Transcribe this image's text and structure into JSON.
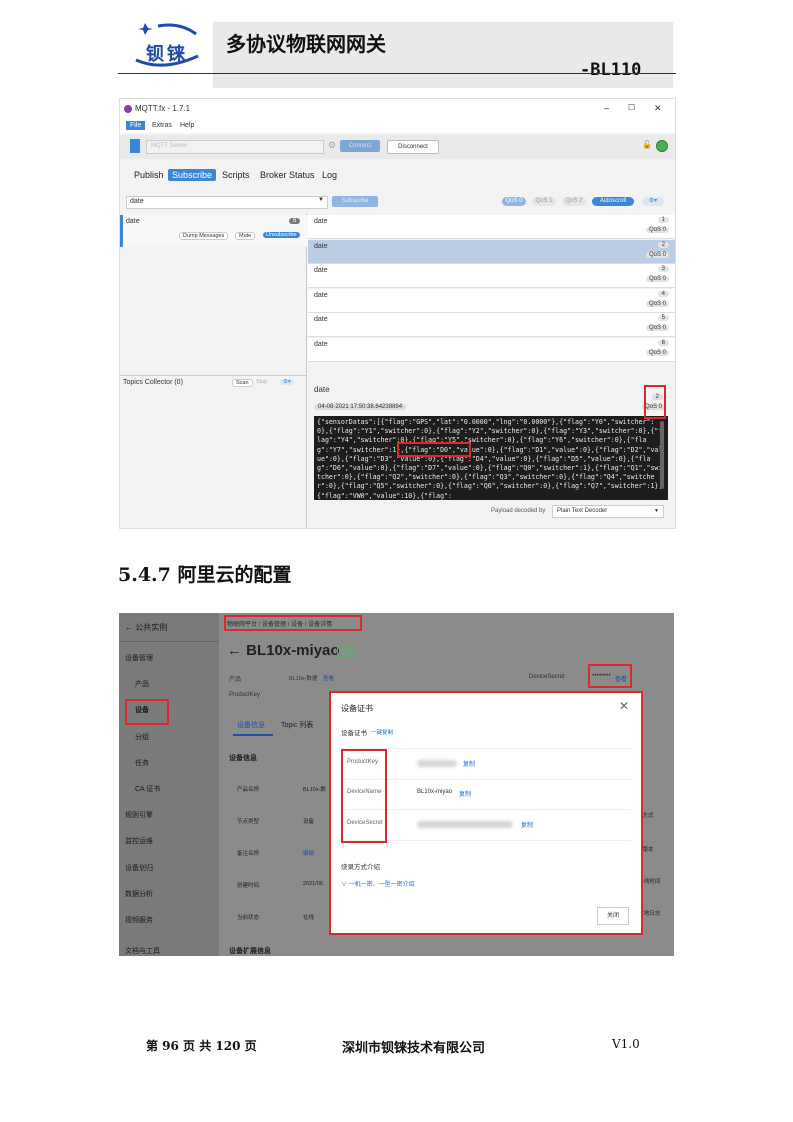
{
  "header": {
    "logo_text": "钡铼",
    "title": "多协议物联网网关",
    "model": "-BL110"
  },
  "mqtt": {
    "window_title": "MQTT.fx - 1.7.1",
    "window_controls": [
      "–",
      "☐",
      "✕"
    ],
    "menu": [
      "File",
      "Extras",
      "Help"
    ],
    "server_placeholder": "MQTT Server",
    "connect_label": "Connect",
    "disconnect_label": "Disconnect",
    "tabs": [
      "Publish",
      "Subscribe",
      "Scripts",
      "Broker Status",
      "Log"
    ],
    "active_tab": "Subscribe",
    "topic_value": "date",
    "subscribe_label": "Subscribe",
    "qos_options": [
      "QoS 0",
      "QoS 1",
      "QoS 2"
    ],
    "autoscroll_label": "Autoscroll",
    "subscription": {
      "topic": "date",
      "count": "6",
      "dump_label": "Dump Messages",
      "mute_label": "Mute",
      "unsubscribe_label": "Unsubscribe"
    },
    "messages": [
      {
        "topic": "date",
        "num": "1",
        "qos": "QoS 0"
      },
      {
        "topic": "date",
        "num": "2",
        "qos": "QoS 0"
      },
      {
        "topic": "date",
        "num": "3",
        "qos": "QoS 0"
      },
      {
        "topic": "date",
        "num": "4",
        "qos": "QoS 0"
      },
      {
        "topic": "date",
        "num": "5",
        "qos": "QoS 0"
      },
      {
        "topic": "date",
        "num": "6",
        "qos": "QoS 0"
      }
    ],
    "topics_collector": "Topics Collector (0)",
    "scan_label": "Scan",
    "stop_label": "Stop",
    "detail": {
      "topic": "date",
      "num": "2",
      "qos": "QoS 0",
      "timestamp": "04-08-2021  17:50:38.64238894",
      "payload": "{\"sensorDatas\":[{\"flag\":\"GPS\",\"lat\":\"0.0000\",\"lng\":\"0.0000\"},{\"flag\":\"Y0\",\"switcher\":0},{\"flag\":\"Y1\",\"switcher\":0},{\"flag\":\"Y2\",\"switcher\":0},{\"flag\":\"Y3\",\"switcher\":0},{\"flag\":\"Y4\",\"switcher\":0},{\"flag\":\"Y5\",\"switcher\":0},{\"flag\":\"Y6\",\"switcher\":0},{\"flag\":\"Y7\",\"switcher\":1},{\"flag\":\"D0\",\"value\":0},{\"flag\":\"D1\",\"value\":0},{\"flag\":\"D2\",\"value\":0},{\"flag\":\"D3\",\"value\":0},{\"flag\":\"D4\",\"value\":0},{\"flag\":\"D5\",\"value\":0},{\"flag\":\"D6\",\"value\":0},{\"flag\":\"D7\",\"value\":0},{\"flag\":\"Q0\",\"switcher\":1},{\"flag\":\"Q1\",\"switcher\":0},{\"flag\":\"Q2\",\"switcher\":0},{\"flag\":\"Q3\",\"switcher\":0},{\"flag\":\"Q4\",\"switcher\":0},{\"flag\":\"Q5\",\"switcher\":0},{\"flag\":\"Q6\",\"switcher\":0},{\"flag\":\"Q7\",\"switcher\":1},{\"flag\":\"VW0\",\"value\":10},{\"flag\":"
    },
    "decoder_label": "Payload decoded by",
    "decoder_value": "Plain Text Decoder"
  },
  "section_title": "5.4.7 阿里云的配置",
  "aliyun": {
    "back_label": "← 公共实例",
    "breadcrumb": [
      "物联网平台",
      "设备管理",
      "设备",
      "设备详情"
    ],
    "sidebar": [
      "设备管理",
      "产品",
      "设备",
      "分组",
      "任务",
      "CA 证书",
      "规则引擎",
      "监控运维",
      "设备划归",
      "数据分析",
      "视频服务",
      "文档与工具"
    ],
    "device_title": "← BL10x-miyao",
    "status": "在线",
    "product_label": "产品",
    "product_value": "BL10x-数据",
    "productkey_label": "ProductKey",
    "view_link": "查看",
    "devicesecret_label": "DeviceSecret",
    "secret_mask": "********",
    "tabs": [
      "设备信息",
      "Topic 列表"
    ],
    "info_title": "设备信息",
    "info_rows": [
      "产品名称",
      "节点类型",
      "备注名称",
      "创建时间",
      "当前状态"
    ],
    "info_values": [
      "BL10x-数",
      "设备",
      "编辑",
      "2021/06",
      "在线"
    ],
    "right_labels": [
      "证方式",
      "件版本",
      "后上线时间",
      "备本地日志"
    ],
    "ext_title": "设备扩展信息",
    "modal": {
      "title": "设备证书",
      "subtitle": "设备证书",
      "copy_all": "一键复制",
      "rows": [
        {
          "label": "ProductKey",
          "value": "",
          "action": "复制"
        },
        {
          "label": "DeviceName",
          "value": "BL10x-miyao",
          "action": "复制"
        },
        {
          "label": "DeviceSecret",
          "value": "",
          "action": "复制"
        }
      ],
      "burn_title": "烧录方式介绍",
      "burn_link": "∨ 一机一密、一型一密介绍",
      "close_label": "关闭"
    }
  },
  "footer": {
    "page": "第  96  页  共  120  页",
    "company": "深圳市钡铼技术有限公司",
    "version": "V1.0"
  }
}
